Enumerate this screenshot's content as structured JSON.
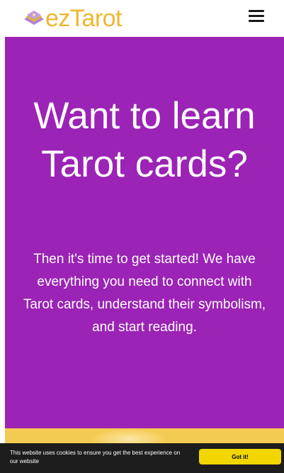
{
  "header": {
    "logo_text": "ezTarot",
    "logo_icon": "tarot-cards-icon",
    "menu_icon": "hamburger-menu-icon"
  },
  "hero": {
    "title": "Want to learn Tarot cards?",
    "subtitle": "Then it's time to get started! We have everything you need to connect with Tarot cards, understand their symbolism, and start reading."
  },
  "cookie_banner": {
    "message": "This website uses cookies to ensure you get the best experience on our website",
    "button_label": "Got it!"
  },
  "colors": {
    "hero_background": "#9b23b5",
    "logo_text": "#f0b630",
    "band": "#f4cb52",
    "cookie_bar": "#1d1d1d",
    "cookie_button": "#f1d600"
  }
}
